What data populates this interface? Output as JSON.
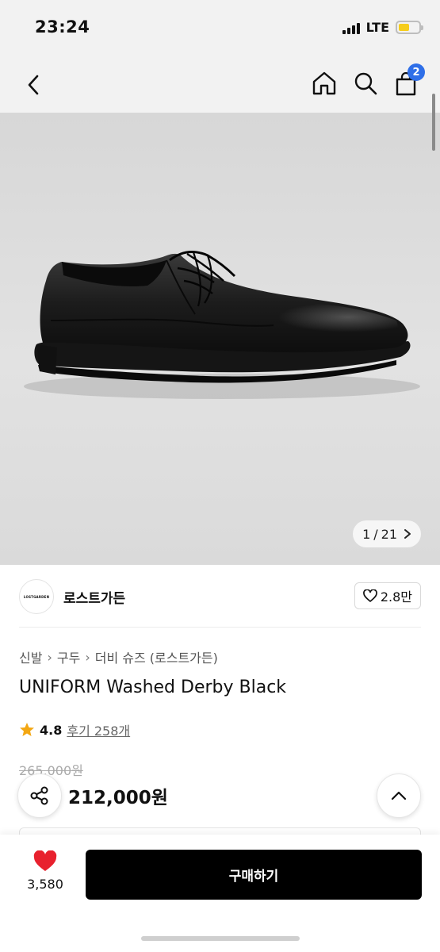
{
  "status_bar": {
    "time": "23:24",
    "network": "LTE",
    "battery_color": "#f6cd1c"
  },
  "nav": {
    "back_icon": "chevron-left-icon",
    "home_icon": "home-icon",
    "search_icon": "search-icon",
    "cart_icon": "shopping-bag-icon",
    "cart_badge": "2",
    "badge_color": "#2f6fe8"
  },
  "gallery": {
    "current": "1",
    "separator": "/",
    "total": "21",
    "next_icon": "chevron-right-icon"
  },
  "brand": {
    "logo_text": "LOSTGARDEN",
    "name": "로스트가든",
    "likes": "2.8만"
  },
  "product": {
    "breadcrumb": [
      "신발",
      "구두",
      "더비 슈즈 (로스트가든)"
    ],
    "title": "UNIFORM Washed Derby Black",
    "rating": "4.8",
    "reviews": "후기 258개",
    "original_price": "265,000원",
    "sale_price": "212,000원",
    "star_color": "#f3a712"
  },
  "bottom_bar": {
    "wish_count": "3,580",
    "heart_color": "#e8212e",
    "buy_label": "구매하기"
  }
}
